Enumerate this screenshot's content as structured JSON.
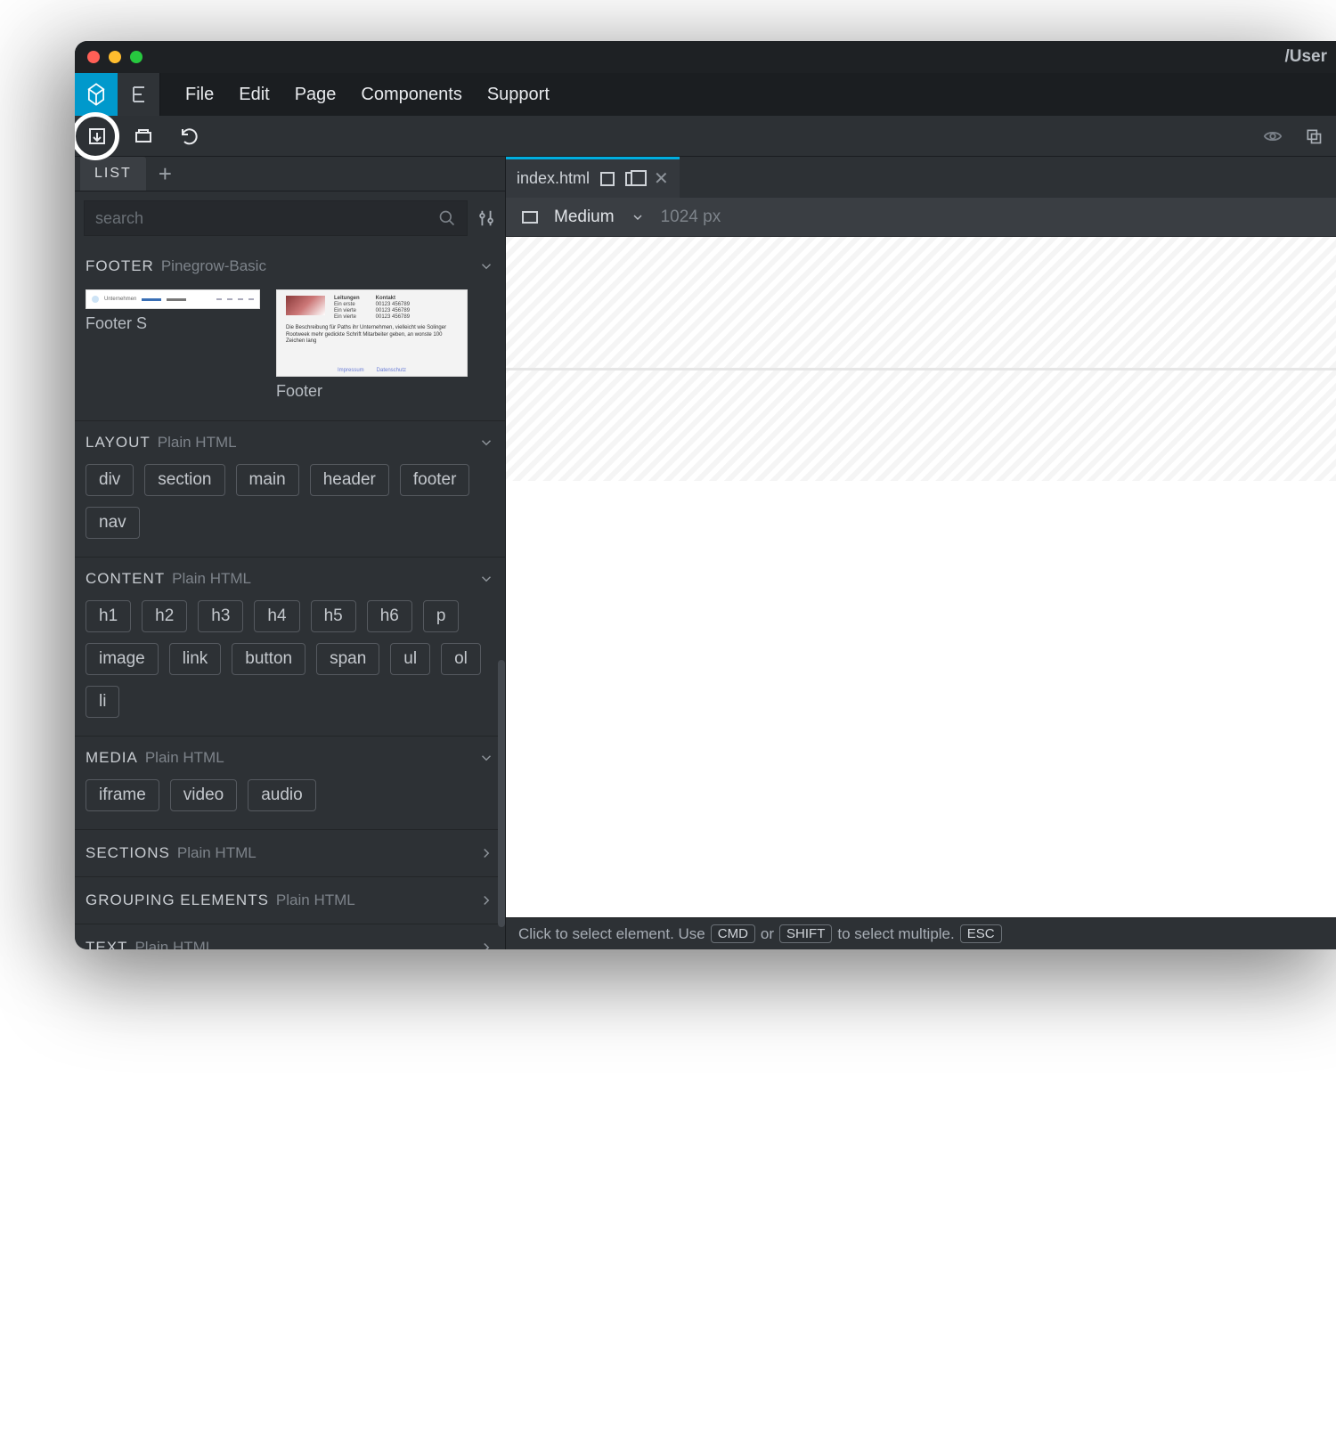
{
  "window": {
    "title_right": "/User"
  },
  "menu": {
    "file": "File",
    "edit": "Edit",
    "page": "Page",
    "components": "Components",
    "support": "Support"
  },
  "sidebar": {
    "tab_label": "LIST",
    "search_placeholder": "search",
    "footer": {
      "title": "FOOTER",
      "sub": "Pinegrow-Basic",
      "items": [
        {
          "label": "Footer S"
        },
        {
          "label": "Footer"
        }
      ]
    },
    "layout": {
      "title": "LAYOUT",
      "sub": "Plain HTML",
      "chips": [
        "div",
        "section",
        "main",
        "header",
        "footer",
        "nav"
      ]
    },
    "content": {
      "title": "CONTENT",
      "sub": "Plain HTML",
      "chips": [
        "h1",
        "h2",
        "h3",
        "h4",
        "h5",
        "h6",
        "p",
        "image",
        "link",
        "button",
        "span",
        "ul",
        "ol",
        "li"
      ]
    },
    "media": {
      "title": "MEDIA",
      "sub": "Plain HTML",
      "chips": [
        "iframe",
        "video",
        "audio"
      ]
    },
    "sections": {
      "title": "SECTIONS",
      "sub": "Plain HTML"
    },
    "grouping": {
      "title": "GROUPING ELEMENTS",
      "sub": "Plain HTML"
    },
    "text": {
      "title": "TEXT",
      "sub": "Plain HTML"
    }
  },
  "main": {
    "tab": {
      "filename": "index.html"
    },
    "breakpoint": {
      "label": "Medium",
      "size": "1024 px"
    }
  },
  "status": {
    "pre": "Click to select element. Use",
    "k1": "CMD",
    "mid": "or",
    "k2": "SHIFT",
    "post": "to select multiple.",
    "k3": "ESC"
  }
}
